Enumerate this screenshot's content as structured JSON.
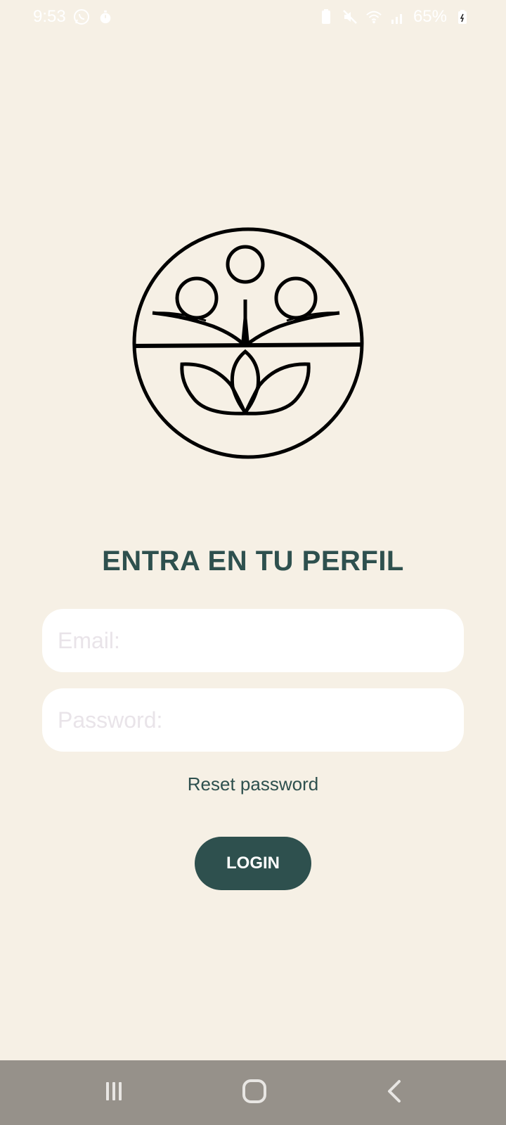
{
  "status_bar": {
    "time": "9:53",
    "battery": "65%",
    "icons": [
      "whatsapp-icon",
      "timer-icon",
      "battery-saver-icon",
      "mute-icon",
      "wifi-icon",
      "signal-icon",
      "battery-icon"
    ]
  },
  "logo": {
    "icon": "community-lotus-logo"
  },
  "login": {
    "title": "ENTRA EN TU PERFIL",
    "email_placeholder": "Email:",
    "email_value": "",
    "password_placeholder": "Password:",
    "password_value": "",
    "reset_label": "Reset password",
    "login_label": "LOGIN"
  },
  "nav": {
    "icons": [
      "recents-icon",
      "home-icon",
      "back-icon"
    ]
  },
  "colors": {
    "background": "#f6f0e5",
    "accent": "#2e504e",
    "input_bg": "#ffffff",
    "nav_bar": "#96918a"
  }
}
